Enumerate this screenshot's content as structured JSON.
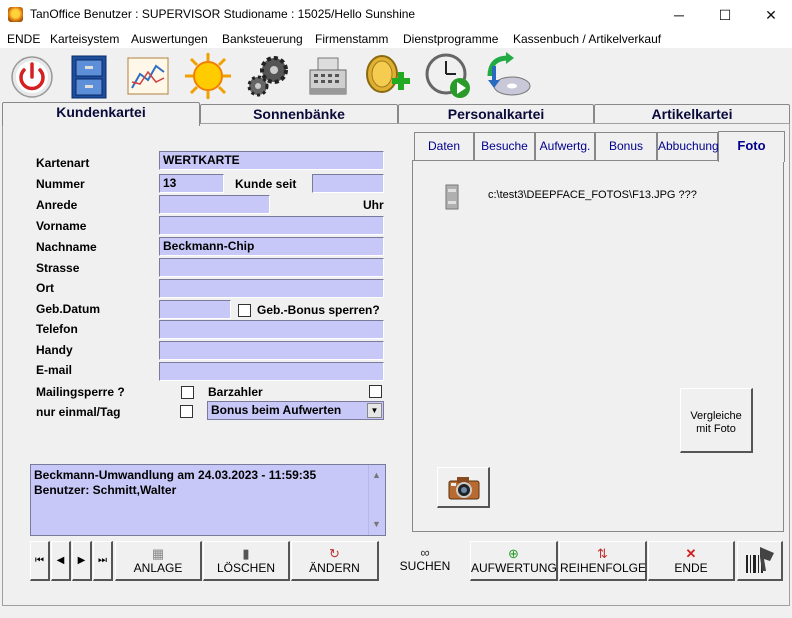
{
  "window": {
    "title": "TanOffice Benutzer : SUPERVISOR  Studioname : 15025/Hello Sunshine",
    "minimize": "─",
    "maximize": "☐",
    "close": "✕"
  },
  "menu": [
    "ENDE",
    "Karteisystem",
    "Auswertungen",
    "Banksteuerung",
    "Firmenstamm",
    "Dienstprogramme",
    "Kassenbuch / Artikelverkauf"
  ],
  "toolbar_icons": [
    "power-icon",
    "file-cabinet-icon",
    "chart-icon",
    "sun-icon",
    "gears-icon",
    "cash-register-icon",
    "coins-add-icon",
    "clock-play-icon",
    "disk-sync-icon"
  ],
  "main_tabs": [
    "Kundenkartei",
    "Sonnenbänke",
    "Personalkartei",
    "Artikelkartei"
  ],
  "form": {
    "kartenart_label": "Kartenart",
    "kartenart_value": "WERTKARTE",
    "nummer_label": "Nummer",
    "nummer_value": "13",
    "kunde_seit_label": "Kunde seit",
    "kunde_seit_value": "",
    "anrede_label": "Anrede",
    "anrede_value": "",
    "uhr_label": "Uhr",
    "vorname_label": "Vorname",
    "vorname_value": "",
    "nachname_label": "Nachname",
    "nachname_value": "Beckmann-Chip",
    "strasse_label": "Strasse",
    "strasse_value": "",
    "ort_label": "Ort",
    "ort_value": "",
    "gebdatum_label": "Geb.Datum",
    "gebdatum_value": "",
    "gebbonus_label": "Geb.-Bonus sperren?",
    "telefon_label": "Telefon",
    "telefon_value": "",
    "handy_label": "Handy",
    "handy_value": "",
    "email_label": "E-mail",
    "email_value": "",
    "mailingsperre_label": "Mailingsperre ?",
    "barzahler_label": "Barzahler",
    "nur_einmal_label": "nur einmal/Tag",
    "bonus_select": "Bonus beim Aufwerten"
  },
  "memo": {
    "line1": "Beckmann-Umwandlung am 24.03.2023 - 11:59:35",
    "line2": "Benutzer: Schmitt,Walter"
  },
  "sub_tabs": [
    "Daten",
    "Besuche",
    "Aufwertg.",
    "Bonus",
    "Abbuchung",
    "Foto"
  ],
  "foto": {
    "path": "c:\\test3\\DEEPFACE_FOTOS\\F13.JPG ???",
    "compare_button_line1": "Vergleiche",
    "compare_button_line2": "mit Foto"
  },
  "nav": [
    "⏮",
    "◀",
    "▶",
    "⏭"
  ],
  "action_buttons": [
    "ANLAGE",
    "LÖSCHEN",
    "ÄNDERN",
    "SUCHEN",
    "AUFWERTUNG",
    "REIHENFOLGE",
    "ENDE"
  ]
}
